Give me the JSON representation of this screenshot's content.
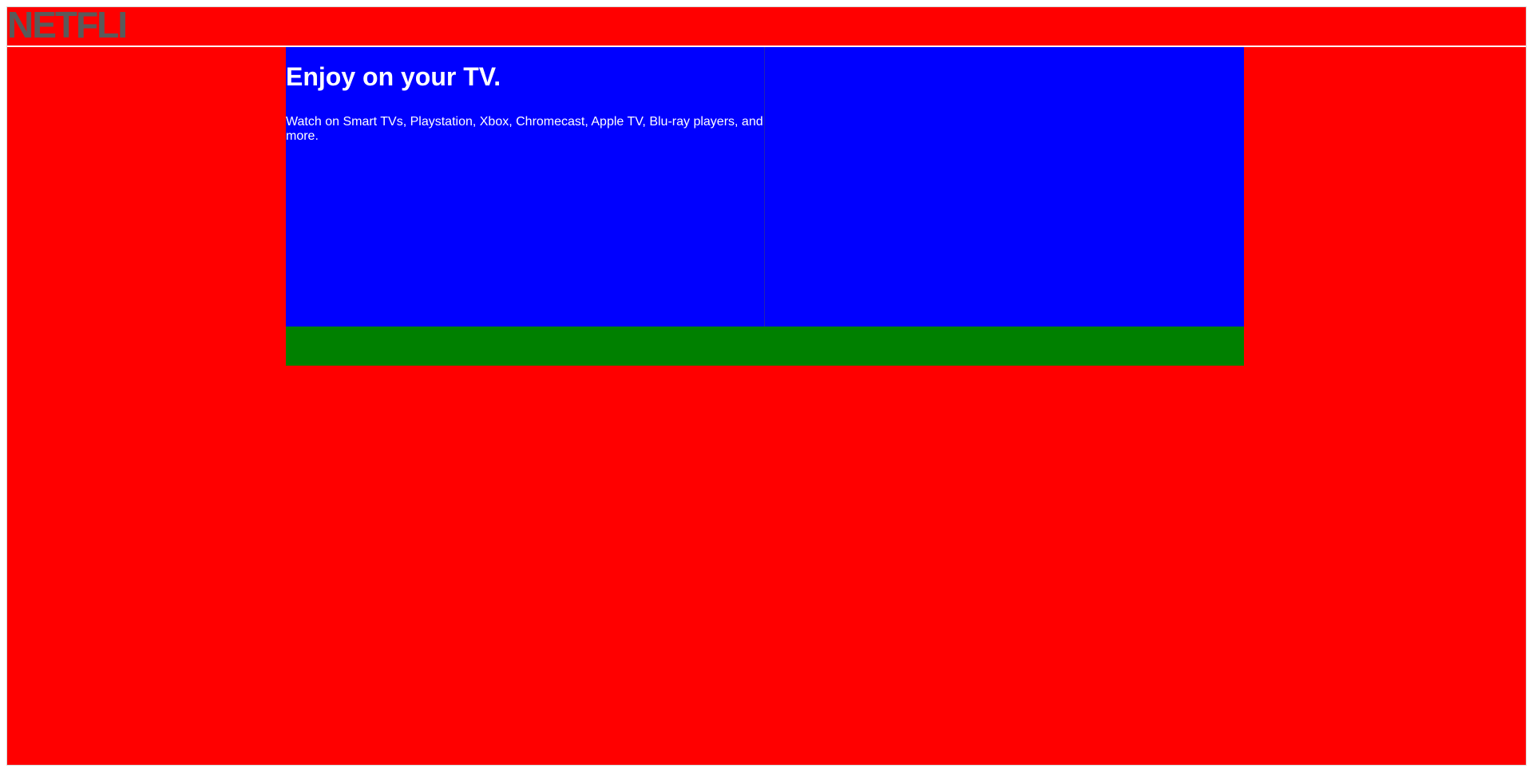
{
  "brand": {
    "logo_text": "NETFLIX",
    "logo_color": "#5a5a5a"
  },
  "colors": {
    "page_bg": "#ff0000",
    "panel_bg": "#0000ff",
    "strip_bg": "#008000",
    "text": "#ffffff"
  },
  "hero": {
    "title": "Enjoy on your TV.",
    "description": "Watch on Smart TVs, Playstation, Xbox, Chromecast, Apple TV, Blu-ray players, and more."
  }
}
